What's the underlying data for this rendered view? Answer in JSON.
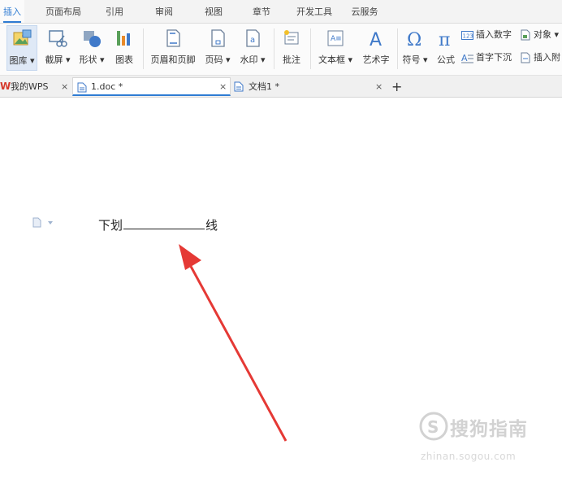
{
  "menu": {
    "tabs": [
      {
        "label": "插入",
        "active": true
      },
      {
        "label": "页面布局"
      },
      {
        "label": "引用"
      },
      {
        "label": "审阅"
      },
      {
        "label": "视图"
      },
      {
        "label": "章节"
      },
      {
        "label": "开发工具"
      },
      {
        "label": "云服务"
      }
    ]
  },
  "ribbon": {
    "picture": "图库 ▾",
    "screenshot": "截屏 ▾",
    "shapes": "形状 ▾",
    "chart": "图表",
    "header_footer": "页眉和页脚",
    "page_number": "页码 ▾",
    "watermark": "水印 ▾",
    "comment": "批注",
    "textbox": "文本框 ▾",
    "wordart": "艺术字",
    "symbol": "符号 ▾",
    "formula": "公式",
    "insert_number": "插入数字",
    "object": "对象 ▾",
    "drop_cap": "首字下沉",
    "insert_attachment": "插入附",
    "textbox_glyph": "A≡",
    "wordart_glyph": "A",
    "symbol_glyph": "Ω",
    "formula_glyph": "π",
    "number_glyph": "123"
  },
  "doc_tabs": {
    "home": "我的WPS",
    "doc1": "1.doc *",
    "doc2": "文档1 *",
    "close": "×",
    "new": "+"
  },
  "document": {
    "text_before": "下划",
    "text_after": "线"
  },
  "watermark": {
    "main": "搜狗指南",
    "sub": "zhinan.sogou.com"
  },
  "colors": {
    "accent": "#2f7cd3",
    "arrow": "#e53935"
  }
}
